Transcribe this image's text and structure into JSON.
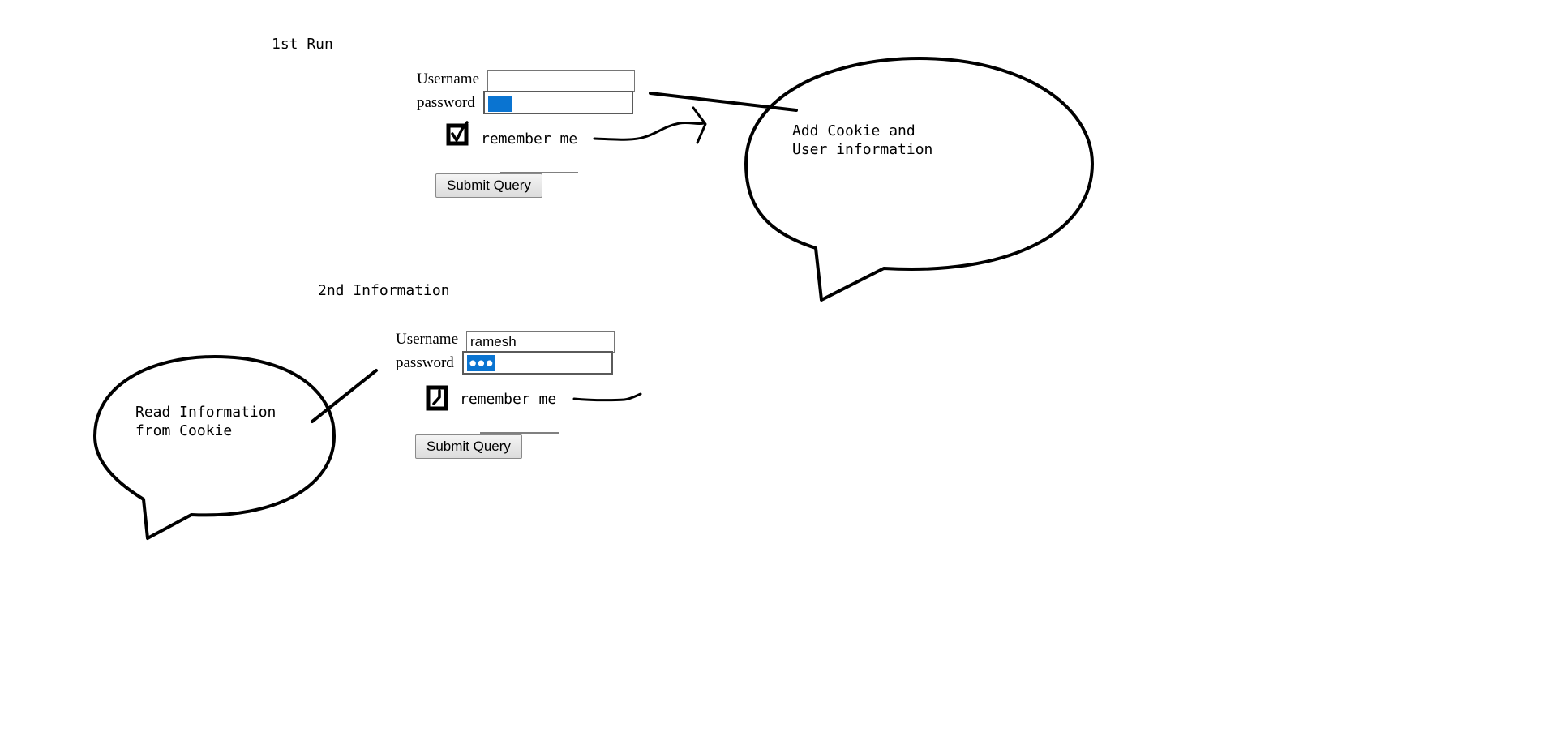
{
  "section1": {
    "title": "1st Run",
    "username_label": "Username",
    "username_value": "",
    "password_label": "password",
    "remember_label": "remember me",
    "submit_label": "Submit Query",
    "bubble_text": "Add Cookie and\nUser information"
  },
  "section2": {
    "title": "2nd Information",
    "username_label": "Username",
    "username_value": "ramesh",
    "password_label": "password",
    "password_value": "●●●",
    "remember_label": "remember me",
    "submit_label": "Submit Query",
    "bubble_text": "Read Information\nfrom Cookie"
  },
  "colors": {
    "selection": "#0a74d1",
    "ink": "#000000"
  },
  "icons": {
    "checkbox_checked": "check-icon",
    "arrow": "hand-drawn-arrow-icon"
  }
}
